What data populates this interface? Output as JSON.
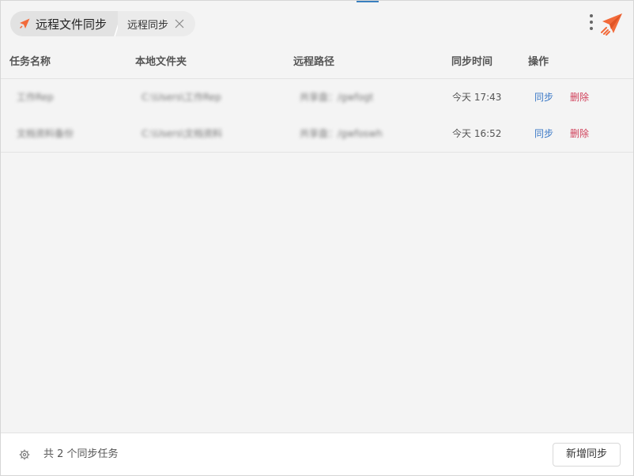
{
  "header": {
    "main_tab_label": "远程文件同步",
    "sub_tab_label": "远程同步",
    "accent_color": "#f26a3a"
  },
  "table": {
    "columns": [
      "任务名称",
      "本地文件夹",
      "远程路径",
      "同步时间",
      "操作"
    ],
    "rows": [
      {
        "name": "工作Rep",
        "local": "C:\\Users\\工作Rep",
        "remote": "共享盘：/gwfogt",
        "time": "今天 17:43",
        "sync": "同步",
        "delete": "删除"
      },
      {
        "name": "文档资料备份",
        "local": "C:\\Users\\文档资料",
        "remote": "共享盘：/gwfoswh",
        "time": "今天 16:52",
        "sync": "同步",
        "delete": "删除"
      }
    ]
  },
  "footer": {
    "count_text": "共 2 个同步任务",
    "add_button_label": "新增同步"
  },
  "icons": {
    "tab": "rocket-icon",
    "close": "close-icon",
    "menu": "more-vertical-icon",
    "logo": "paper-plane-logo",
    "settings": "gear-icon"
  }
}
